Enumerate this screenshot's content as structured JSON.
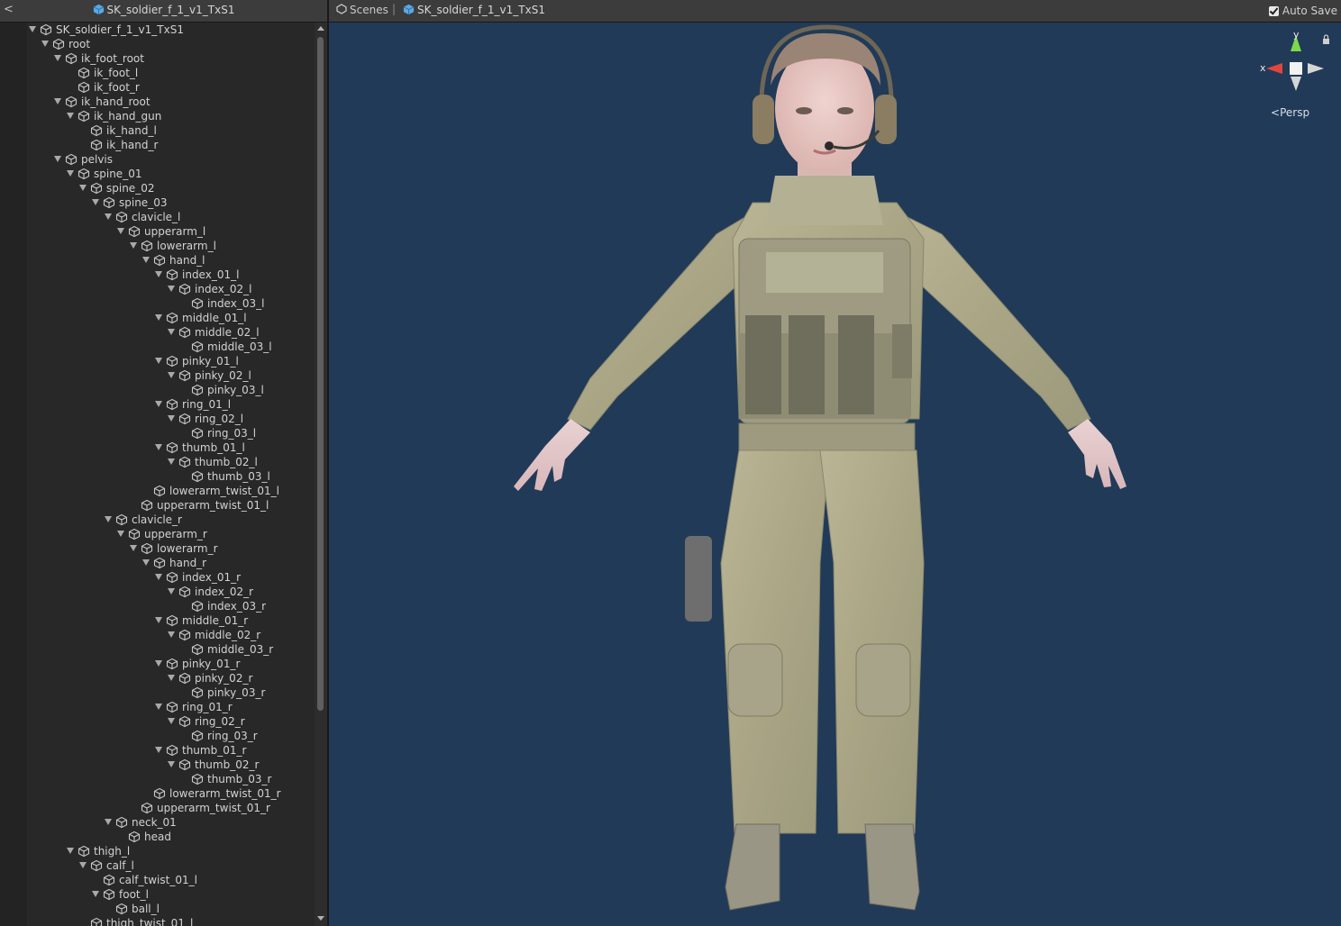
{
  "left_panel": {
    "back_glyph": "<",
    "title": "SK_soldier_f_1_v1_TxS1"
  },
  "hierarchy": [
    {
      "label": "SK_soldier_f_1_v1_TxS1",
      "depth": 0,
      "expanded": true
    },
    {
      "label": "root",
      "depth": 1,
      "expanded": true
    },
    {
      "label": "ik_foot_root",
      "depth": 2,
      "expanded": true
    },
    {
      "label": "ik_foot_l",
      "depth": 3,
      "expanded": false
    },
    {
      "label": "ik_foot_r",
      "depth": 3,
      "expanded": false
    },
    {
      "label": "ik_hand_root",
      "depth": 2,
      "expanded": true
    },
    {
      "label": "ik_hand_gun",
      "depth": 3,
      "expanded": true
    },
    {
      "label": "ik_hand_l",
      "depth": 4,
      "expanded": false
    },
    {
      "label": "ik_hand_r",
      "depth": 4,
      "expanded": false
    },
    {
      "label": "pelvis",
      "depth": 2,
      "expanded": true
    },
    {
      "label": "spine_01",
      "depth": 3,
      "expanded": true
    },
    {
      "label": "spine_02",
      "depth": 4,
      "expanded": true
    },
    {
      "label": "spine_03",
      "depth": 5,
      "expanded": true
    },
    {
      "label": "clavicle_l",
      "depth": 6,
      "expanded": true
    },
    {
      "label": "upperarm_l",
      "depth": 7,
      "expanded": true
    },
    {
      "label": "lowerarm_l",
      "depth": 8,
      "expanded": true
    },
    {
      "label": "hand_l",
      "depth": 9,
      "expanded": true
    },
    {
      "label": "index_01_l",
      "depth": 10,
      "expanded": true
    },
    {
      "label": "index_02_l",
      "depth": 11,
      "expanded": true
    },
    {
      "label": "index_03_l",
      "depth": 12,
      "expanded": false
    },
    {
      "label": "middle_01_l",
      "depth": 10,
      "expanded": true
    },
    {
      "label": "middle_02_l",
      "depth": 11,
      "expanded": true
    },
    {
      "label": "middle_03_l",
      "depth": 12,
      "expanded": false
    },
    {
      "label": "pinky_01_l",
      "depth": 10,
      "expanded": true
    },
    {
      "label": "pinky_02_l",
      "depth": 11,
      "expanded": true
    },
    {
      "label": "pinky_03_l",
      "depth": 12,
      "expanded": false
    },
    {
      "label": "ring_01_l",
      "depth": 10,
      "expanded": true
    },
    {
      "label": "ring_02_l",
      "depth": 11,
      "expanded": true
    },
    {
      "label": "ring_03_l",
      "depth": 12,
      "expanded": false
    },
    {
      "label": "thumb_01_l",
      "depth": 10,
      "expanded": true
    },
    {
      "label": "thumb_02_l",
      "depth": 11,
      "expanded": true
    },
    {
      "label": "thumb_03_l",
      "depth": 12,
      "expanded": false
    },
    {
      "label": "lowerarm_twist_01_l",
      "depth": 9,
      "expanded": false
    },
    {
      "label": "upperarm_twist_01_l",
      "depth": 8,
      "expanded": false
    },
    {
      "label": "clavicle_r",
      "depth": 6,
      "expanded": true
    },
    {
      "label": "upperarm_r",
      "depth": 7,
      "expanded": true
    },
    {
      "label": "lowerarm_r",
      "depth": 8,
      "expanded": true
    },
    {
      "label": "hand_r",
      "depth": 9,
      "expanded": true
    },
    {
      "label": "index_01_r",
      "depth": 10,
      "expanded": true
    },
    {
      "label": "index_02_r",
      "depth": 11,
      "expanded": true
    },
    {
      "label": "index_03_r",
      "depth": 12,
      "expanded": false
    },
    {
      "label": "middle_01_r",
      "depth": 10,
      "expanded": true
    },
    {
      "label": "middle_02_r",
      "depth": 11,
      "expanded": true
    },
    {
      "label": "middle_03_r",
      "depth": 12,
      "expanded": false
    },
    {
      "label": "pinky_01_r",
      "depth": 10,
      "expanded": true
    },
    {
      "label": "pinky_02_r",
      "depth": 11,
      "expanded": true
    },
    {
      "label": "pinky_03_r",
      "depth": 12,
      "expanded": false
    },
    {
      "label": "ring_01_r",
      "depth": 10,
      "expanded": true
    },
    {
      "label": "ring_02_r",
      "depth": 11,
      "expanded": true
    },
    {
      "label": "ring_03_r",
      "depth": 12,
      "expanded": false
    },
    {
      "label": "thumb_01_r",
      "depth": 10,
      "expanded": true
    },
    {
      "label": "thumb_02_r",
      "depth": 11,
      "expanded": true
    },
    {
      "label": "thumb_03_r",
      "depth": 12,
      "expanded": false
    },
    {
      "label": "lowerarm_twist_01_r",
      "depth": 9,
      "expanded": false
    },
    {
      "label": "upperarm_twist_01_r",
      "depth": 8,
      "expanded": false
    },
    {
      "label": "neck_01",
      "depth": 6,
      "expanded": true
    },
    {
      "label": "head",
      "depth": 7,
      "expanded": false
    },
    {
      "label": "thigh_l",
      "depth": 3,
      "expanded": true
    },
    {
      "label": "calf_l",
      "depth": 4,
      "expanded": true
    },
    {
      "label": "calf_twist_01_l",
      "depth": 5,
      "expanded": false
    },
    {
      "label": "foot_l",
      "depth": 5,
      "expanded": true
    },
    {
      "label": "ball_l",
      "depth": 6,
      "expanded": false
    },
    {
      "label": "thigh_twist_01_l",
      "depth": 4,
      "expanded": false
    }
  ],
  "scene_header": {
    "scenes_label": "Scenes",
    "separator": "|",
    "prefab_label": "SK_soldier_f_1_v1_TxS1",
    "autosave_label": "Auto Save",
    "autosave_checked": true
  },
  "gizmo": {
    "y_label": "y",
    "x_label": "x",
    "projection_label": "Persp",
    "lock_icon": "lock-icon"
  },
  "colors": {
    "viewport_bg": "#213a58",
    "panel_bg": "#282828",
    "header_bg": "#3c3c3c",
    "prefab_icon": "#5aa9e6",
    "gizmo_x": "#e0463c",
    "gizmo_y": "#7ed94a"
  }
}
